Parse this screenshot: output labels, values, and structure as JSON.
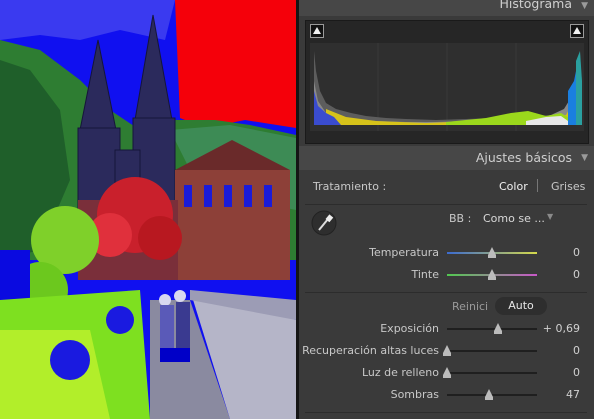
{
  "histogram": {
    "title": "Histograma",
    "expand_icon": "triangle-down"
  },
  "basic": {
    "title": "Ajustes básicos",
    "treatment_label": "Tratamiento :",
    "treatment_color": "Color",
    "treatment_gray": "Grises",
    "wb_label": "BB :",
    "wb_value": "Como se ...",
    "tone_reset": "Reinici",
    "tone_auto": "Auto"
  },
  "sliders": [
    {
      "label": "Temperatura",
      "value": "0",
      "level": 0.5
    },
    {
      "label": "Tinte",
      "value": "0",
      "level": 0.5
    },
    {
      "label": "Exposición",
      "value": "+ 0,69",
      "level": 0.57
    },
    {
      "label": "Recuperación altas luces",
      "value": "0",
      "level": 0.0
    },
    {
      "label": "Luz de relleno",
      "value": "0",
      "level": 0.0
    },
    {
      "label": "Sombras",
      "value": "47",
      "level": 0.47
    }
  ],
  "colors": {
    "panel": "#3a3a3a",
    "header": "#474747",
    "text": "#cfcfcf"
  }
}
